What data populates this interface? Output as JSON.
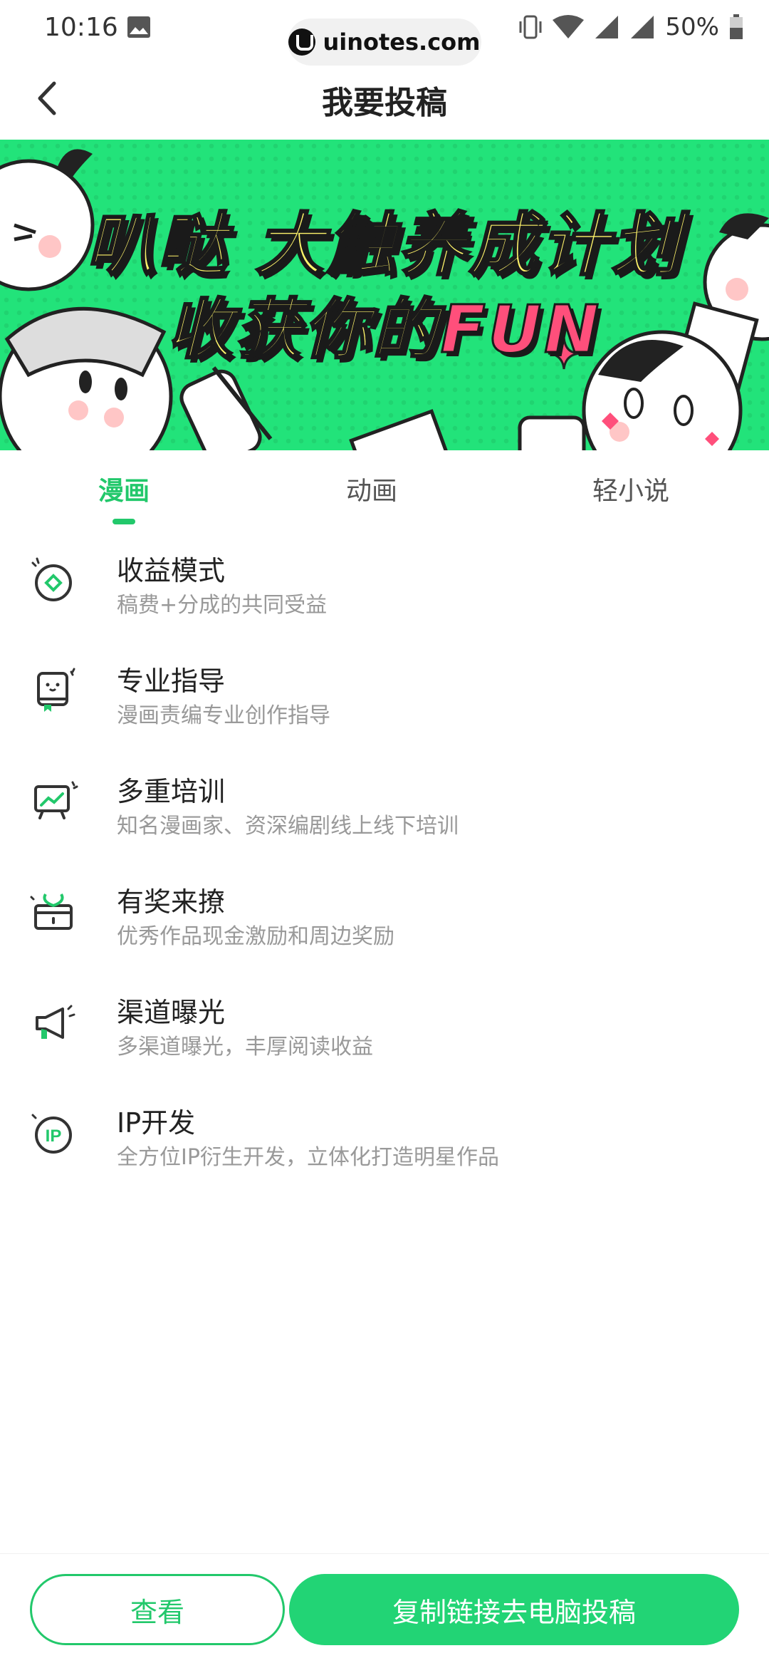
{
  "status": {
    "time": "10:16",
    "watermark": "uinotes.com",
    "battery": "50%"
  },
  "nav": {
    "title": "我要投稿"
  },
  "banner": {
    "line1": "叭哒 大触养成计划",
    "line2_prefix": "收获你的",
    "line2_highlight": "FUN"
  },
  "tabs": [
    {
      "label": "漫画",
      "active": true
    },
    {
      "label": "动画",
      "active": false
    },
    {
      "label": "轻小说",
      "active": false
    }
  ],
  "features": [
    {
      "icon": "coin-icon",
      "title": "收益模式",
      "desc": "稿费+分成的共同受益"
    },
    {
      "icon": "book-icon",
      "title": "专业指导",
      "desc": "漫画责编专业创作指导"
    },
    {
      "icon": "chart-board-icon",
      "title": "多重培训",
      "desc": "知名漫画家、资深编剧线上线下培训"
    },
    {
      "icon": "gift-icon",
      "title": "有奖来撩",
      "desc": "优秀作品现金激励和周边奖励"
    },
    {
      "icon": "megaphone-icon",
      "title": "渠道曝光",
      "desc": "多渠道曝光，丰厚阅读收益"
    },
    {
      "icon": "ip-icon",
      "title": "IP开发",
      "desc": "全方位IP衍生开发，立体化打造明星作品"
    }
  ],
  "buttons": {
    "view": "查看",
    "copy": "复制链接去电脑投稿"
  },
  "colors": {
    "accent": "#22c86b",
    "banner_bg": "#22e37a",
    "banner_text": "#fff46a",
    "banner_highlight": "#ff4f7b"
  }
}
